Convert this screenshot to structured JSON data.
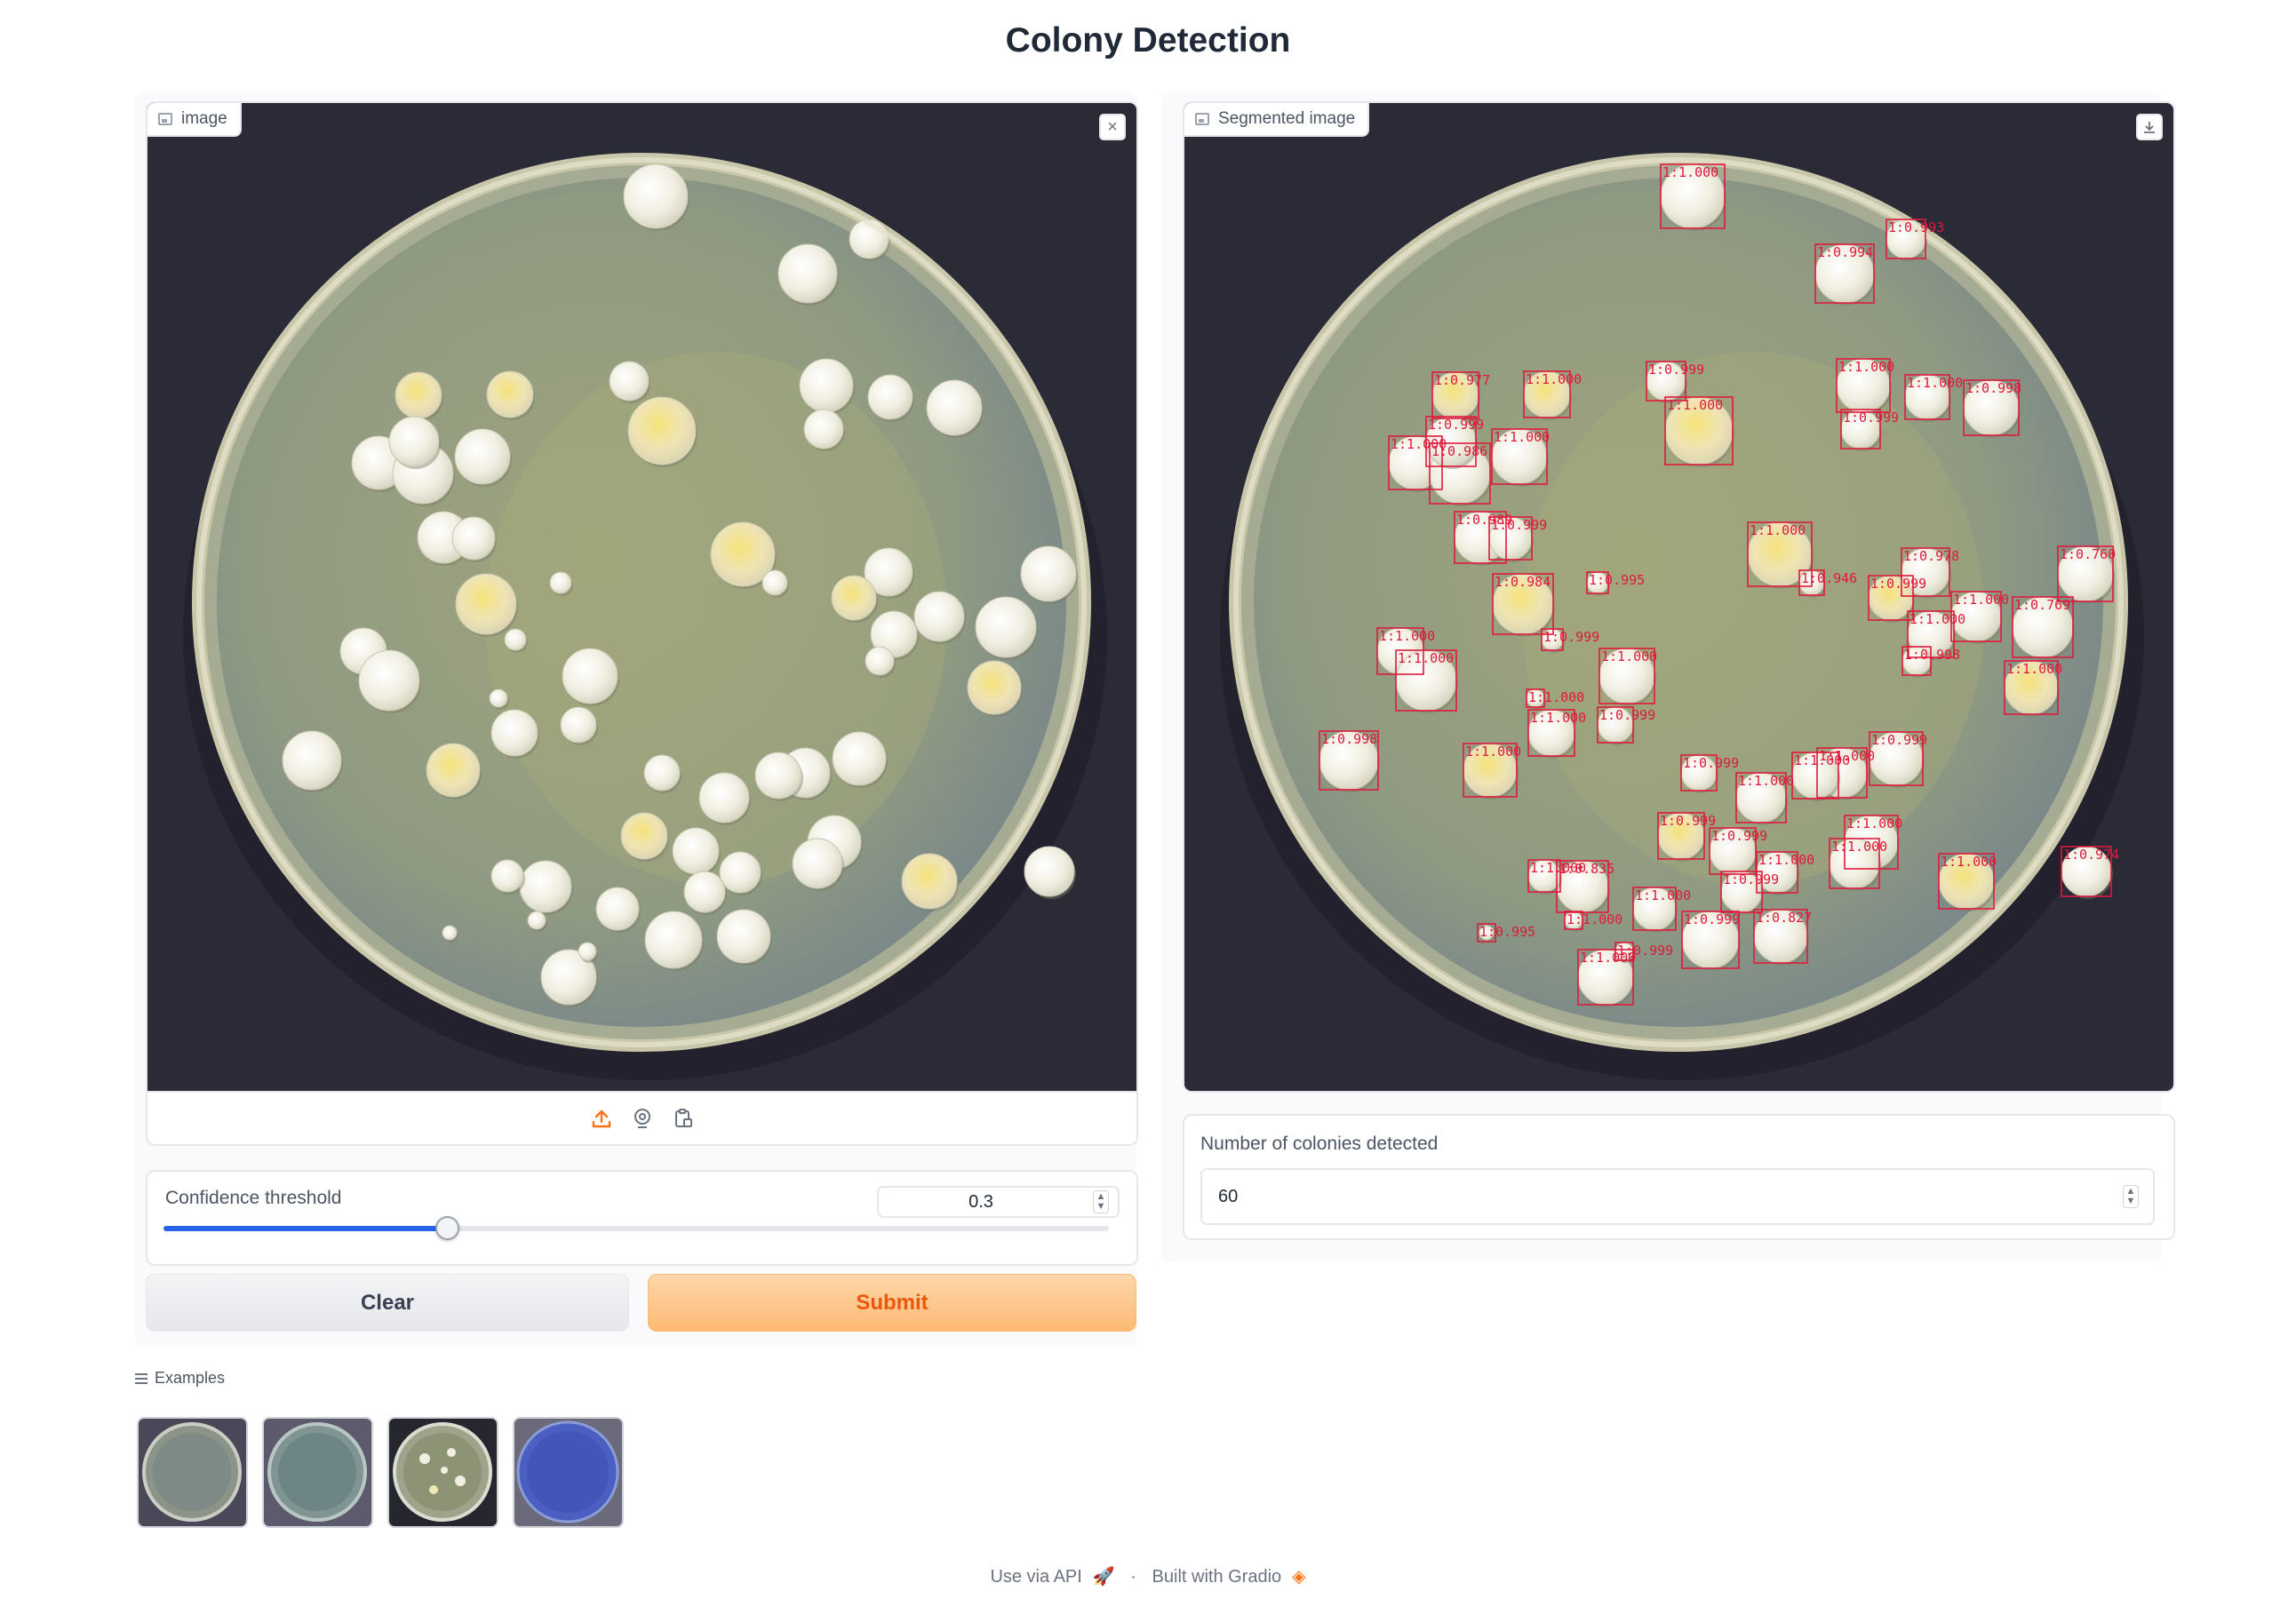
{
  "page": {
    "title": "Colony Detection"
  },
  "input_panel": {
    "label": "image",
    "close_icon": "close-icon"
  },
  "output_panel": {
    "label": "Segmented image",
    "download_icon": "download-icon"
  },
  "slider": {
    "label": "Confidence threshold",
    "value": "0.3",
    "fraction": 0.3
  },
  "colonies": {
    "label": "Number of colonies detected",
    "value": "60"
  },
  "buttons": {
    "clear": "Clear",
    "submit": "Submit"
  },
  "examples": {
    "label": "Examples"
  },
  "footer": {
    "api": "Use via API",
    "sep": "·",
    "built": "Built with Gradio"
  },
  "detections": [
    "1:1.000",
    "1:0.994",
    "1:0.993",
    "1:0.977",
    "1:1.000",
    "1:0.999",
    "1:1.000",
    "1:1.000",
    "1:1.000",
    "1:0.999",
    "1:0.998",
    "1:1.000",
    "1:0.986",
    "1:0.999",
    "1:1.000",
    "1:0.989",
    "1:0.999",
    "1:1.000",
    "1:0.984",
    "1:0.978",
    "1:0.999",
    "1:1.000",
    "1:1.000",
    "1:0.998",
    "1:1.000",
    "1:1.000",
    "1:1.000",
    "1:0.999",
    "1:1.000",
    "1:1.000",
    "1:0.999",
    "1:1.000",
    "1:0.998",
    "1:1.000",
    "1:0.999",
    "1:1.000",
    "1:1.000",
    "1:1.000",
    "1:0.999",
    "1:1.000",
    "1:0.999",
    "1:1.000",
    "1:0.999",
    "1:1.000",
    "1:0.835",
    "1:1.000",
    "1:1.000",
    "1:0.999",
    "1:0.827",
    "1:1.000",
    "1:0.974",
    "1:0.769",
    "1:0.760",
    "1:0.946",
    "1:0.995",
    "1:0.999",
    "1:1.000",
    "1:0.999",
    "1:1.000",
    "1:0.995"
  ]
}
